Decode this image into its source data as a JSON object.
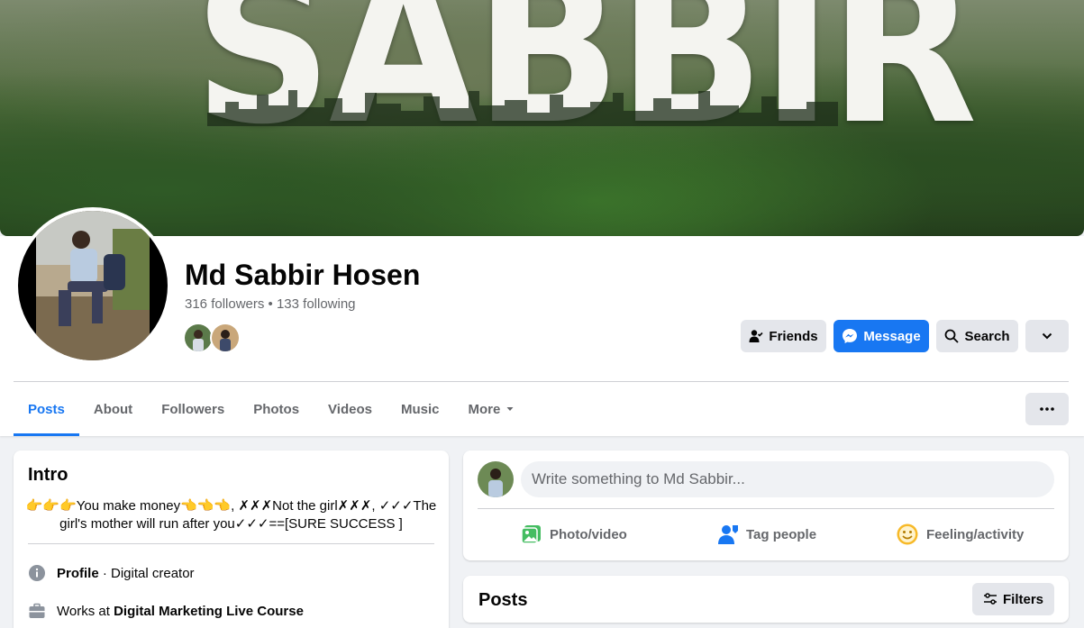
{
  "cover": {
    "title": "SABBIR"
  },
  "profile": {
    "name": "Md Sabbir Hosen",
    "followers_line": "316 followers • 133 following"
  },
  "actions": {
    "friends": "Friends",
    "message": "Message",
    "search": "Search"
  },
  "tabs": [
    {
      "label": "Posts",
      "active": true
    },
    {
      "label": "About"
    },
    {
      "label": "Followers"
    },
    {
      "label": "Photos"
    },
    {
      "label": "Videos"
    },
    {
      "label": "Music"
    },
    {
      "label": "More"
    }
  ],
  "intro": {
    "title": "Intro",
    "bio": "👉👉👉You make money👈👈👈, ✗✗✗Not the girl✗✗✗, ✓✓✓The girl's mother will run after you✓✓✓==[SURE SUCCESS ]",
    "profile_label": "Profile",
    "profile_value": " · Digital creator",
    "work_prefix": "Works at ",
    "work_place": "Digital Marketing Live Course"
  },
  "composer": {
    "placeholder": "Write something to Md Sabbir...",
    "photo_video": "Photo/video",
    "tag_people": "Tag people",
    "feeling": "Feeling/activity"
  },
  "posts": {
    "title": "Posts",
    "filters": "Filters"
  },
  "colors": {
    "accent": "#1877f2",
    "secondary_text": "#65676b",
    "button_gray": "#e4e6eb"
  }
}
